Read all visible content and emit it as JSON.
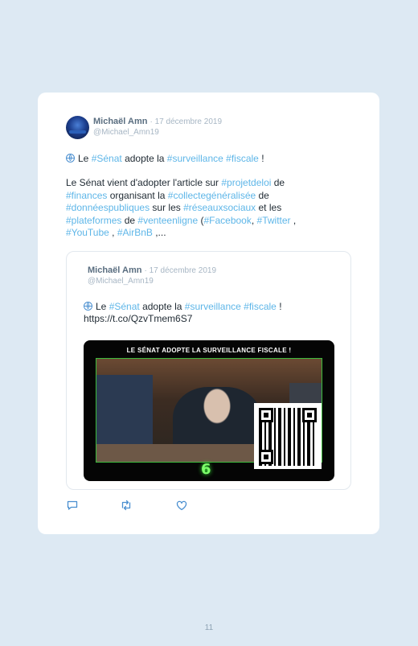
{
  "tweet": {
    "author_name": "Michaël Amn",
    "date": "· 17 décembre 2019",
    "handle": "@Michael_Amn19",
    "line1": {
      "t1": "Le ",
      "h1": "#Sénat",
      "t2": " adopte la ",
      "h2": "#surveillance",
      "t3": " ",
      "h3": "#fiscale",
      "t4": " !"
    },
    "p2": {
      "a1": "Le Sénat vient d'adopter l'article sur ",
      "a2": "#projetdeloi",
      "a3": " de",
      "b1": "#finances",
      "b2": " organisant la ",
      "b3": "#collectegénéralisée",
      "b4": " de",
      "c1": "#donnéespubliques",
      "c2": " sur les ",
      "c3": "#réseauxsociaux",
      "c4": " et les",
      "d1": "#plateformes",
      "d2": " de ",
      "d3": "#venteenligne",
      "d4": " (",
      "d5": "#Facebook",
      "d6": ", ",
      "d7": "#Twitter",
      "d8": " ,",
      "e1": "#YouTube",
      "e2": " , ",
      "e3": "#AirBnB",
      "e4": " ,..."
    }
  },
  "quoted": {
    "author_name": "Michaël Amn",
    "date": "· 17 décembre 2019",
    "handle": "@Michael_Amn19",
    "line1": {
      "t1": "Le ",
      "h1": "#Sénat",
      "t2": " adopte la ",
      "h2": "#surveillance",
      "t3": " ",
      "h3": "#fiscale",
      "t4": " !"
    },
    "link": "https://t.co/QzvTmem6S7",
    "media": {
      "banner": "LE SÉNAT ADOPTE LA SURVEILLANCE FISCALE !",
      "channel_logo": "6"
    }
  },
  "actions": {
    "icons": [
      "reply-icon",
      "retweet-icon",
      "like-icon"
    ]
  },
  "page": {
    "number": "11"
  },
  "colors": {
    "hashtag": "#5eb6e8",
    "background": "#dde9f3",
    "name": "#5a6e80"
  }
}
